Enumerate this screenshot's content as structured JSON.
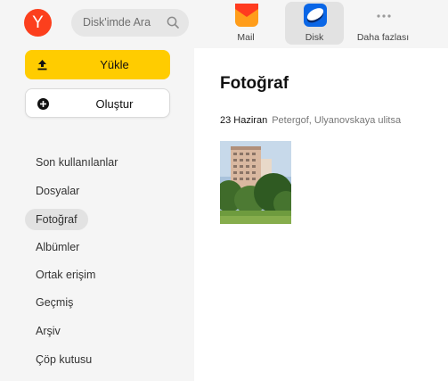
{
  "header": {
    "logo": "Y",
    "search": {
      "placeholder": "Disk'imde Ara",
      "icon": "search-icon"
    },
    "apps": [
      {
        "label": "Mail",
        "icon": "mail-icon"
      },
      {
        "label": "Disk",
        "icon": "disk-icon",
        "active": true
      },
      {
        "label": "Daha fazlası",
        "icon": "more-icon"
      }
    ]
  },
  "sidebar": {
    "upload_label": "Yükle",
    "create_label": "Oluştur",
    "items": [
      {
        "label": "Son kullanılanlar"
      },
      {
        "label": "Dosyalar"
      },
      {
        "label": "Fotoğraf",
        "active": true
      },
      {
        "label": "Albümler"
      },
      {
        "label": "Ortak erişim"
      },
      {
        "label": "Geçmiş"
      },
      {
        "label": "Arşiv"
      },
      {
        "label": "Çöp kutusu"
      }
    ]
  },
  "main": {
    "title": "Fotoğraf",
    "group": {
      "date": "23 Haziran",
      "place": "Petergof, Ulyanovskaya ulitsa"
    }
  },
  "colors": {
    "accent": "#ffcc00",
    "brand": "#fc3f1d",
    "sidebar_bg": "#f5f5f5",
    "active_bg": "#e2e2e2"
  }
}
